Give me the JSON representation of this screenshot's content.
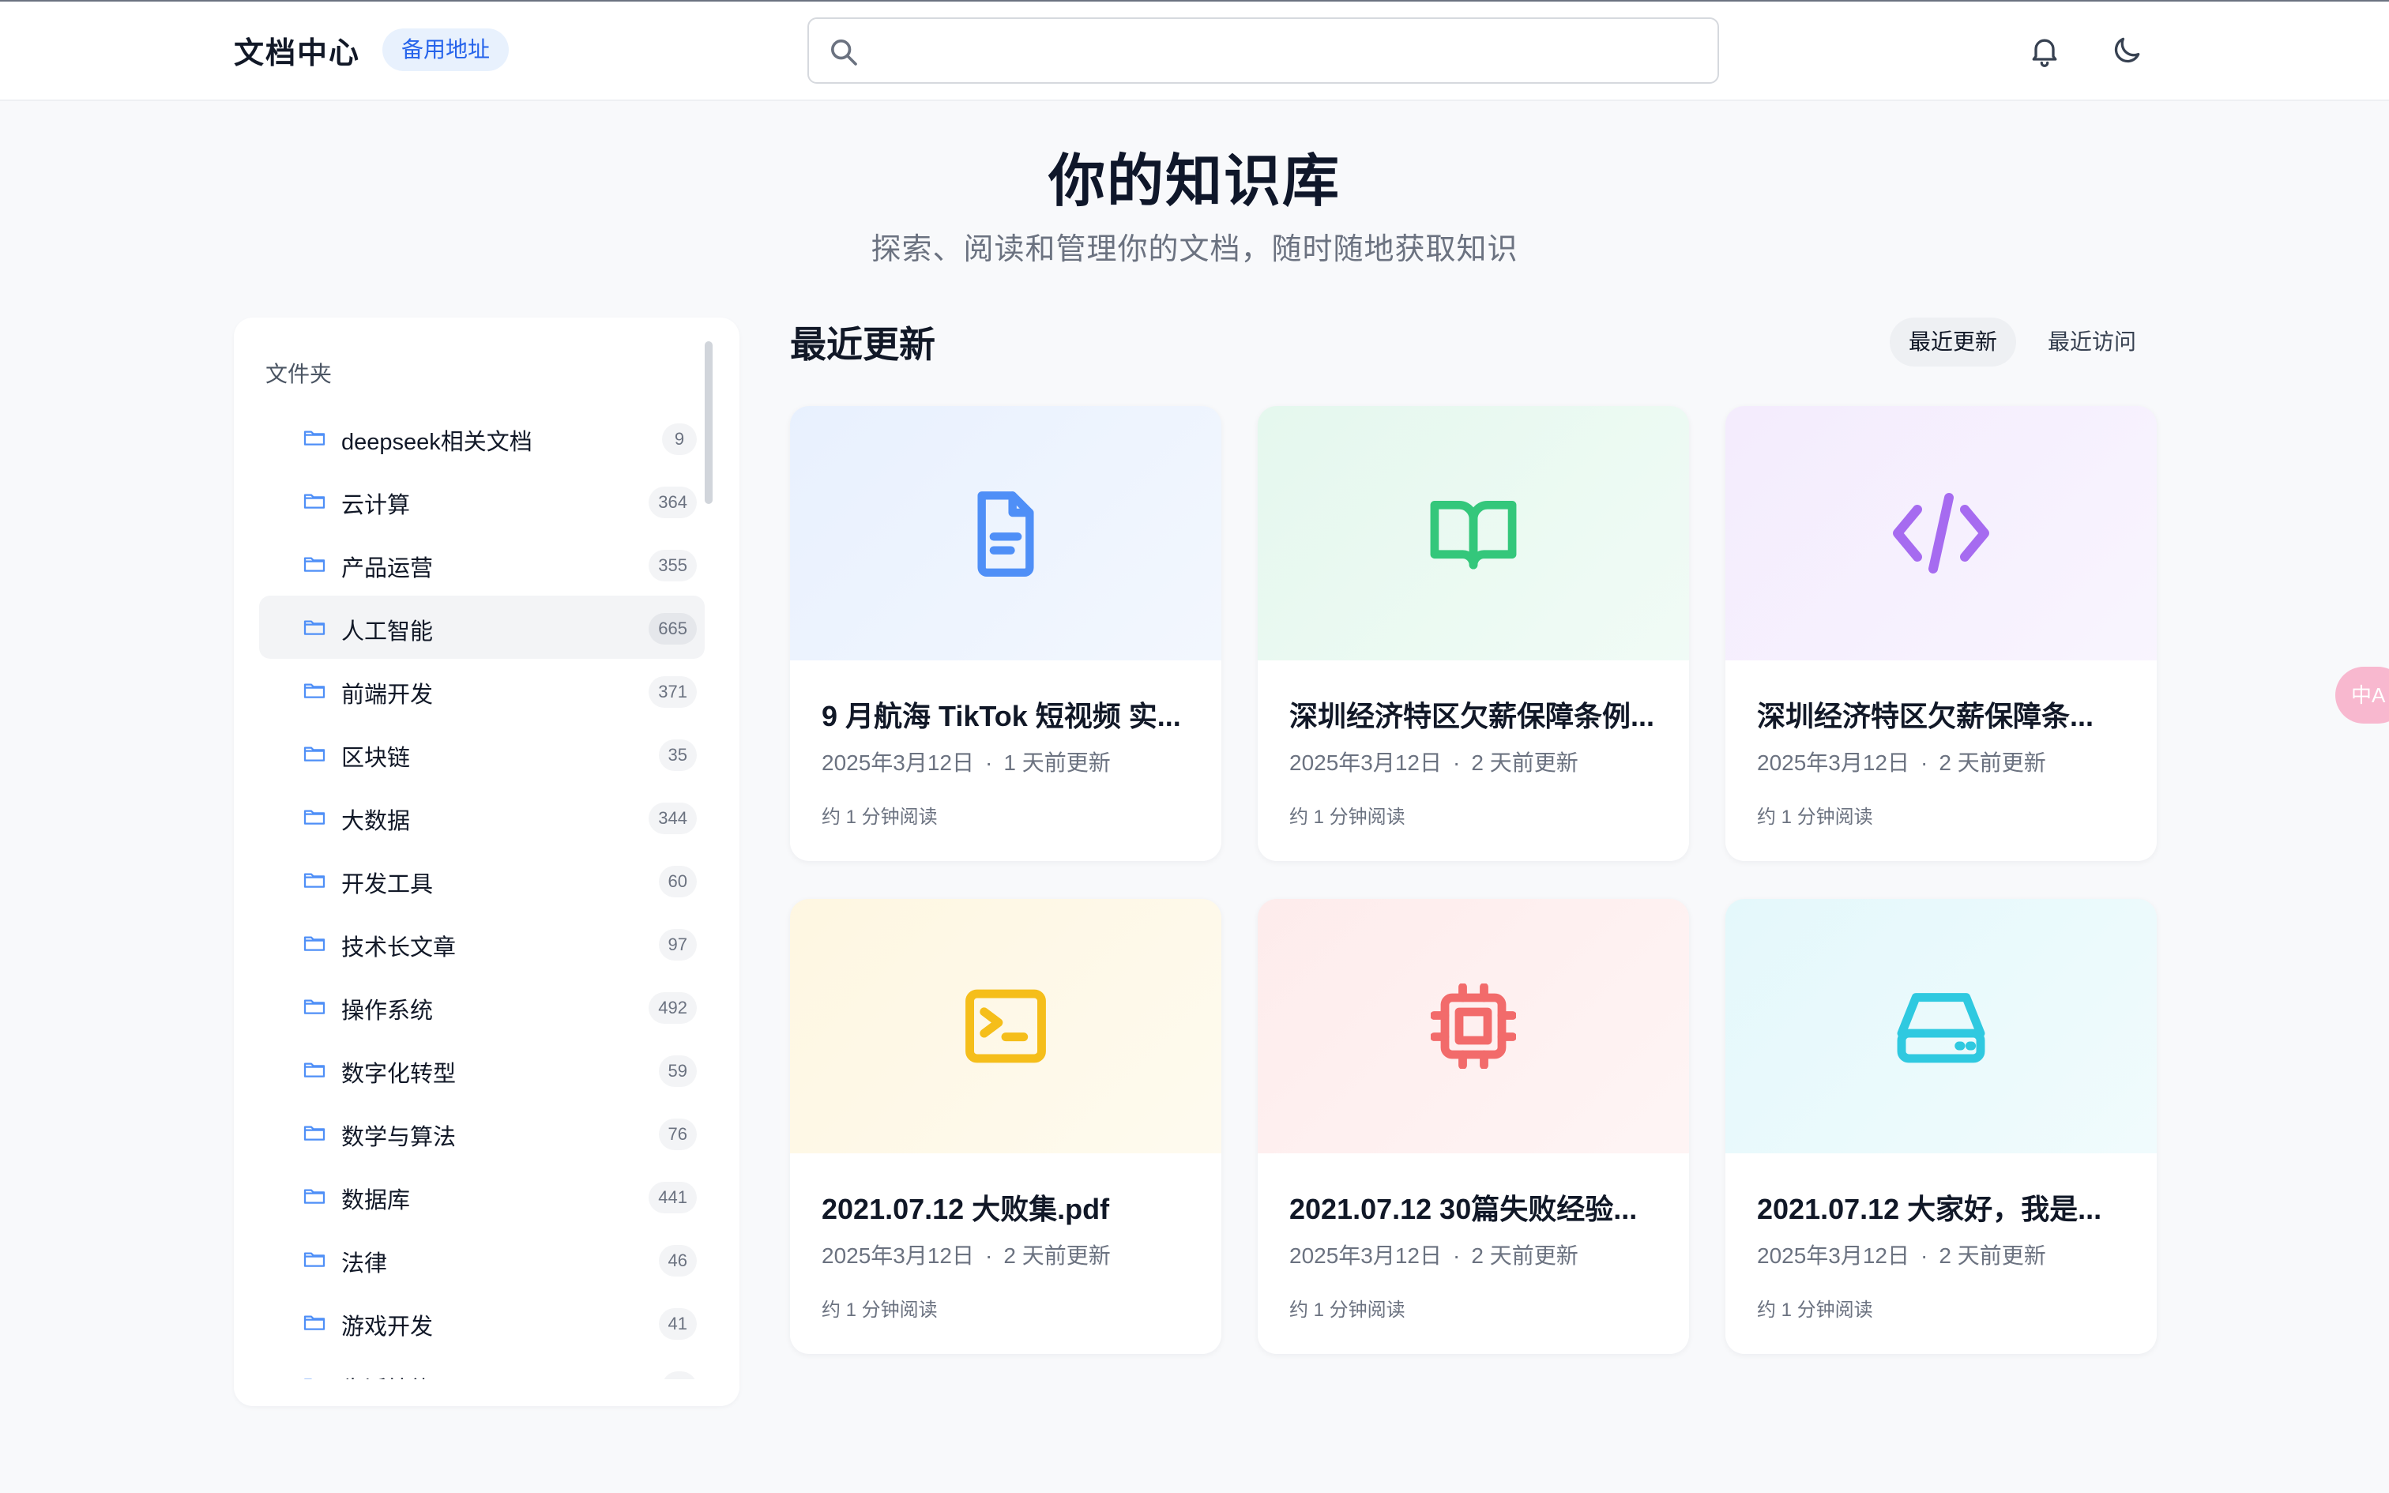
{
  "header": {
    "brand": "文档中心",
    "alt_badge": "备用地址",
    "search_placeholder": "",
    "icons": [
      "search-icon",
      "bell-icon",
      "moon-icon"
    ]
  },
  "hero": {
    "title": "你的知识库",
    "subtitle": "探索、阅读和管理你的文档，随时随地获取知识"
  },
  "sidebar": {
    "title": "文件夹",
    "items": [
      {
        "label": "deepseek相关文档",
        "count": "9"
      },
      {
        "label": "云计算",
        "count": "364"
      },
      {
        "label": "产品运营",
        "count": "355"
      },
      {
        "label": "人工智能",
        "count": "665",
        "active": true
      },
      {
        "label": "前端开发",
        "count": "371"
      },
      {
        "label": "区块链",
        "count": "35"
      },
      {
        "label": "大数据",
        "count": "344"
      },
      {
        "label": "开发工具",
        "count": "60"
      },
      {
        "label": "技术长文章",
        "count": "97"
      },
      {
        "label": "操作系统",
        "count": "492"
      },
      {
        "label": "数字化转型",
        "count": "59"
      },
      {
        "label": "数学与算法",
        "count": "76"
      },
      {
        "label": "数据库",
        "count": "441"
      },
      {
        "label": "法律",
        "count": "46"
      },
      {
        "label": "游戏开发",
        "count": "41"
      },
      {
        "label": "生活技能",
        "count": ""
      }
    ]
  },
  "main": {
    "section_title": "最近更新",
    "tabs": [
      {
        "label": "最近更新",
        "active": true
      },
      {
        "label": "最近访问",
        "active": false
      }
    ],
    "cards": [
      {
        "title": "9 月航海 TikTok 短视频 实...",
        "date": "2025年3月12日",
        "updated": "1 天前更新",
        "read": "约 1 分钟阅读",
        "icon": "document-icon",
        "accent": "#4f8ff7"
      },
      {
        "title": "深圳经济特区欠薪保障条例...",
        "date": "2025年3月12日",
        "updated": "2 天前更新",
        "read": "约 1 分钟阅读",
        "icon": "book-icon",
        "accent": "#34c77b"
      },
      {
        "title": "深圳经济特区欠薪保障条...",
        "date": "2025年3月12日",
        "updated": "2 天前更新",
        "read": "约 1 分钟阅读",
        "icon": "code-icon",
        "accent": "#a66bf0"
      },
      {
        "title": "2021.07.12 大败集.pdf",
        "date": "2025年3月12日",
        "updated": "2 天前更新",
        "read": "约 1 分钟阅读",
        "icon": "terminal-icon",
        "accent": "#f5be1a"
      },
      {
        "title": "2021.07.12 30篇失败经验...",
        "date": "2025年3月12日",
        "updated": "2 天前更新",
        "read": "约 1 分钟阅读",
        "icon": "cpu-icon",
        "accent": "#f26b6b"
      },
      {
        "title": "2021.07.12 大家好，我是...",
        "date": "2025年3月12日",
        "updated": "2 天前更新",
        "read": "约 1 分钟阅读",
        "icon": "drive-icon",
        "accent": "#2fc9e0"
      }
    ]
  },
  "fab": {
    "label": "中A",
    "color": "#f8b8cf"
  }
}
